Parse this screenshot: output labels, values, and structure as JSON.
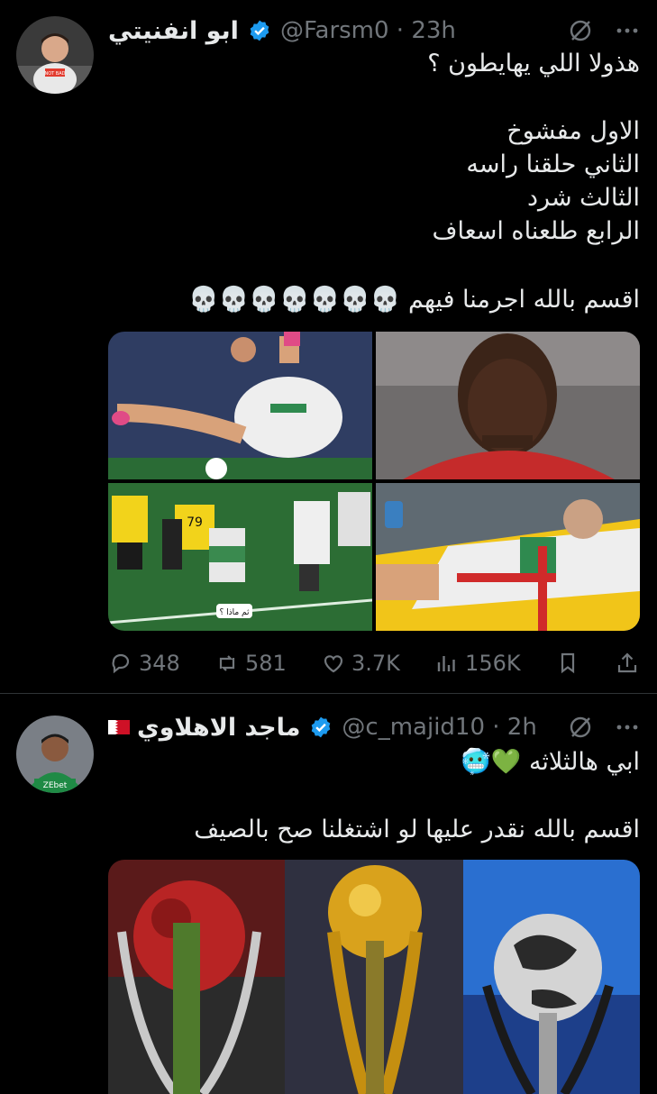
{
  "tweets": [
    {
      "display_name": "ابو انفنيتي",
      "handle_time": "@Farsm0 · 23h",
      "text_line1": "هذولا اللي يهايطون ؟",
      "text_block": "الاول مفشوخ\nالثاني حلقنا راسه\nالثالث شرد\nالرابع طلعناه اسعاف",
      "text_last": "اقسم بالله اجرمنا فيهم 💀💀💀💀💀💀💀",
      "avatar_shirt_text": "NOT BAD",
      "media_caption": "ثم ماذا ؟",
      "metrics": {
        "replies": "348",
        "reposts": "581",
        "likes": "3.7K",
        "views": "156K"
      }
    },
    {
      "display_name": "ماجد الاهلاوي",
      "handle_time": "@c_majid10 · 2h",
      "text_line1": "ابي هالثلاثه 💚🥶",
      "text_last": "اقسم بالله نقدر عليها لو اشتغلنا صح بالصيف",
      "avatar_shirt_text": "ZEbet"
    }
  ],
  "icons": {
    "verified": "verified-badge-icon",
    "grok": "grok-icon",
    "more": "more-icon",
    "reply": "reply-icon",
    "repost": "repost-icon",
    "like": "like-icon",
    "views": "views-icon",
    "bookmark": "bookmark-icon",
    "share": "share-icon"
  },
  "colors": {
    "background": "#000000",
    "text": "#e7e9ea",
    "muted": "#71767b",
    "verified": "#1d9bf0",
    "divider": "#2f3336"
  }
}
